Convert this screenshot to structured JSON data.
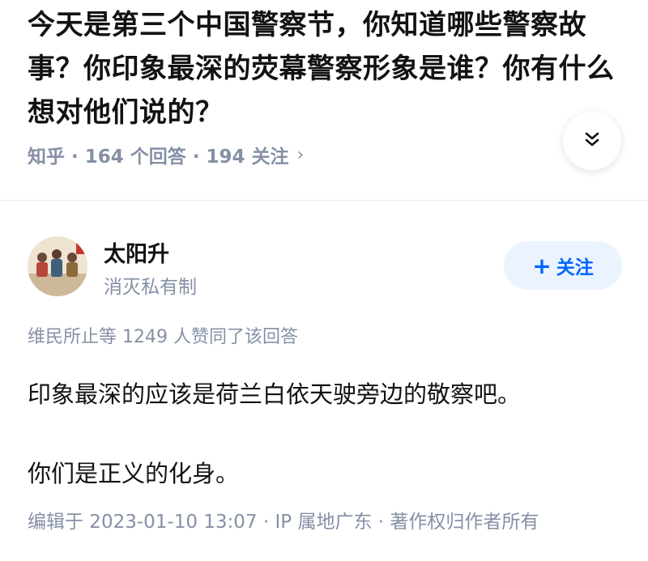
{
  "question": {
    "title": "今天是第三个中国警察节，你知道哪些警察故事？你印象最深的荧幕警察形象是谁？你有什么想对他们说的？",
    "meta": "知乎 · 164 个回答 · 194 关注",
    "meta_chevron": "›",
    "expand_icon": "double-chevron-down-icon"
  },
  "answer": {
    "author_name": "太阳升",
    "author_bio": "消灭私有制",
    "follow_label": "关注",
    "follow_plus": "+",
    "votes_line": "维民所止等 1249 人赞同了该回答",
    "paragraphs": [
      "印象最深的应该是荷兰白依天驶旁边的敬察吧。",
      "你们是正义的化身。"
    ],
    "footer": "编辑于 2023-01-10 13:07 · IP 属地广东 · 著作权归作者所有"
  },
  "colors": {
    "text_primary": "#121212",
    "text_secondary": "#8590a6",
    "accent": "#0066ff",
    "follow_bg": "#ebf3ff"
  }
}
